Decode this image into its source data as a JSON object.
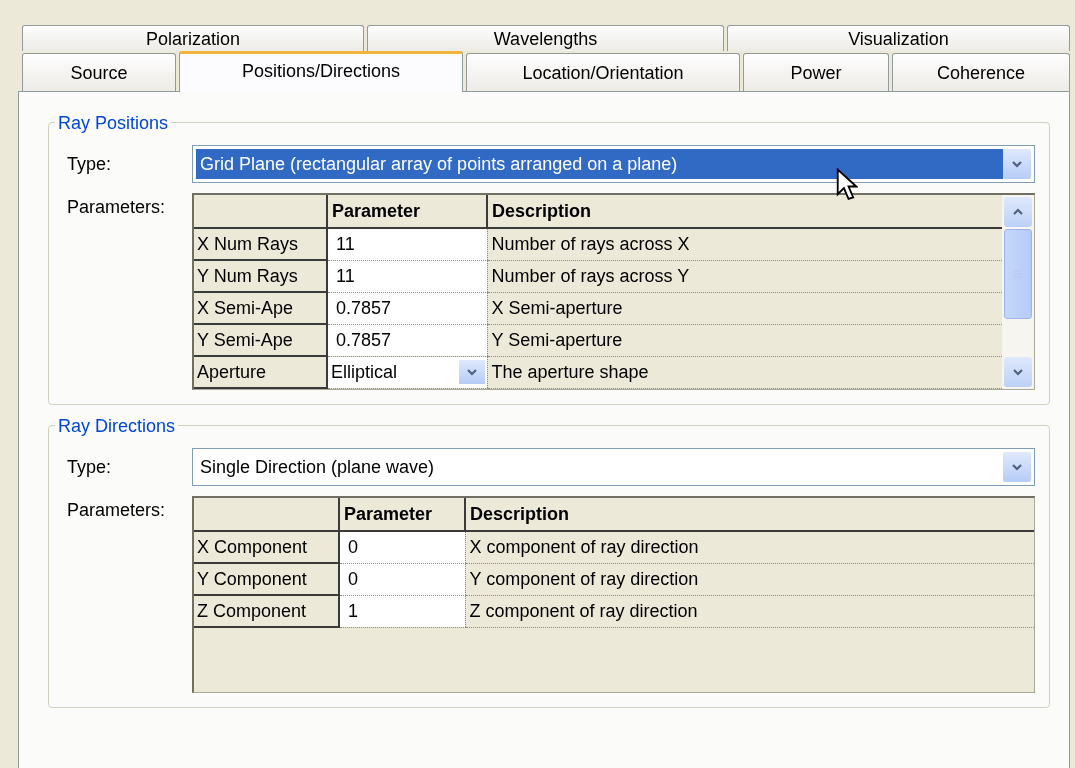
{
  "tab_rows": [
    {
      "tabs": [
        {
          "label": "Polarization",
          "selected": false
        },
        {
          "label": "Wavelengths",
          "selected": false
        },
        {
          "label": "Visualization",
          "selected": false
        }
      ]
    },
    {
      "tabs": [
        {
          "label": "Source",
          "selected": false
        },
        {
          "label": "Positions/Directions",
          "selected": true
        },
        {
          "label": "Location/Orientation",
          "selected": false
        },
        {
          "label": "Power",
          "selected": false
        },
        {
          "label": "Coherence",
          "selected": false
        }
      ]
    }
  ],
  "sections": [
    {
      "title": "Ray Positions",
      "type_label": "Type:",
      "type_value": "Grid Plane (rectangular array of points arranged on a plane)",
      "type_selected": true,
      "parameters_label": "Parameters:",
      "scrollbar": true,
      "columns": [
        "Parameter",
        "Description"
      ],
      "rows": [
        {
          "name": "X Num Rays",
          "value": "11",
          "description": "Number of rays across X",
          "kind": "text"
        },
        {
          "name": "Y Num Rays",
          "value": "11",
          "description": "Number of rays across Y",
          "kind": "text"
        },
        {
          "name": "X Semi-Ape",
          "value": "0.7857",
          "description": "X Semi-aperture",
          "kind": "text"
        },
        {
          "name": "Y Semi-Ape",
          "value": "0.7857",
          "description": "Y Semi-aperture",
          "kind": "text"
        },
        {
          "name": "Aperture",
          "value": "Elliptical",
          "description": "The aperture shape",
          "kind": "dropdown"
        }
      ]
    },
    {
      "title": "Ray Directions",
      "type_label": "Type:",
      "type_value": "Single Direction (plane wave)",
      "type_selected": false,
      "parameters_label": "Parameters:",
      "scrollbar": false,
      "columns": [
        "Parameter",
        "Description"
      ],
      "rows": [
        {
          "name": "X Component",
          "value": "0",
          "description": "X component of ray direction",
          "kind": "text"
        },
        {
          "name": "Y Component",
          "value": "0",
          "description": "Y component of ray direction",
          "kind": "text"
        },
        {
          "name": "Z Component",
          "value": "1",
          "description": "Z component of ray direction",
          "kind": "text"
        }
      ]
    }
  ]
}
